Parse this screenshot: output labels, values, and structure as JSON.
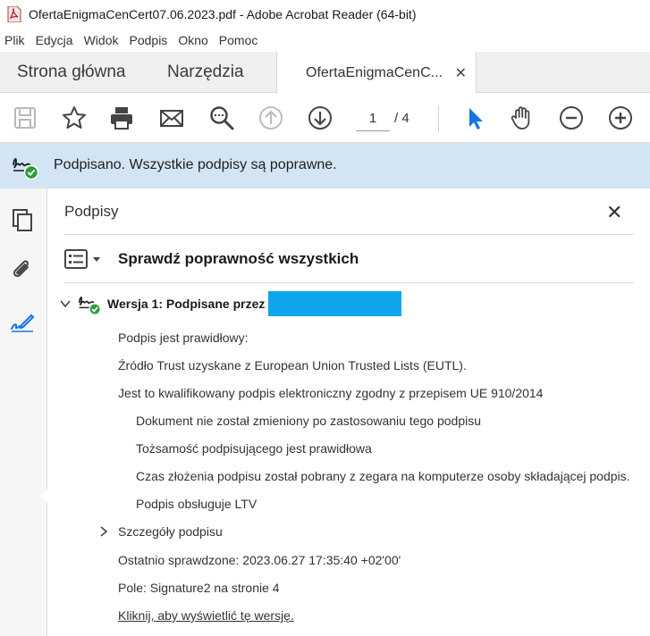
{
  "window": {
    "title": "OfertaEnigmaCenCert07.06.2023.pdf - Adobe Acrobat Reader (64-bit)",
    "app_icon": "pdf-icon"
  },
  "menu": [
    "Plik",
    "Edycja",
    "Widok",
    "Podpis",
    "Okno",
    "Pomoc"
  ],
  "tabs": {
    "home": "Strona główna",
    "tools": "Narzędzia",
    "document": "OfertaEnigmaCenC...",
    "close_glyph": "✕"
  },
  "toolbar": {
    "icons": [
      "save-icon",
      "star-icon",
      "print-icon",
      "email-icon",
      "zoom-search-icon",
      "page-up-icon",
      "page-down-icon",
      "select-pointer-icon",
      "hand-icon",
      "zoom-out-icon",
      "zoom-in-icon"
    ],
    "current_page": "1",
    "total_pages": "/ 4"
  },
  "signature_bar": {
    "message": "Podpisano. Wszystkie podpisy są poprawne."
  },
  "left_rail": [
    "pages-icon",
    "attachment-icon",
    "signature-pen-icon"
  ],
  "panel": {
    "title": "Podpisy",
    "close_glyph": "✕",
    "validate_all": "Sprawdź poprawność wszystkich",
    "version_label": "Wersja 1: Podpisane przez",
    "lines": {
      "valid": "Podpis jest prawidłowy:",
      "trust_source": "Źródło Trust uzyskane z European Union Trusted Lists (EUTL).",
      "qualified": "Jest to kwalifikowany podpis elektroniczny zgodny z przepisem UE 910/2014",
      "unchanged": "Dokument nie został zmieniony po zastosowaniu tego podpisu",
      "identity": "Tożsamość podpisującego jest prawidłowa",
      "time": "Czas złożenia podpisu został pobrany z zegara na komputerze osoby składającej podpis.",
      "ltv": "Podpis obsługuje LTV",
      "details": "Szczegóły podpisu",
      "last_checked": "Ostatnio sprawdzone: 2023.06.27 17:35:40 +02'00'",
      "field": "Pole: Signature2 na stronie 4",
      "view_version": "Kliknij, aby wyświetlić tę wersję."
    }
  },
  "colors": {
    "sig_bar_bg": "#d3e4f4",
    "redaction": "#0ea5ea",
    "accent_blue": "#1473e6",
    "valid_green": "#2d9d3a"
  }
}
